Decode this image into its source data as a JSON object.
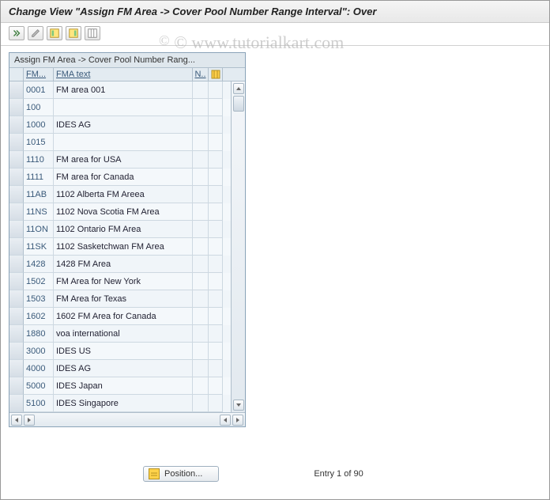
{
  "title": "Change View \"Assign FM Area -> Cover Pool Number Range Interval\": Over",
  "watermark": "© www.tutorialkart.com",
  "table": {
    "caption": "Assign FM Area -> Cover Pool Number Rang...",
    "headers": {
      "fm": "FM...",
      "txt": "FMA text",
      "n": "N.."
    },
    "rows": [
      {
        "fm": "0001",
        "txt": "FM area 001"
      },
      {
        "fm": "100",
        "txt": ""
      },
      {
        "fm": "1000",
        "txt": "IDES AG"
      },
      {
        "fm": "1015",
        "txt": ""
      },
      {
        "fm": "1110",
        "txt": "FM area for USA"
      },
      {
        "fm": "1111",
        "txt": "FM area for Canada"
      },
      {
        "fm": "11AB",
        "txt": "1102 Alberta FM Areea"
      },
      {
        "fm": "11NS",
        "txt": "1102 Nova Scotia FM Area"
      },
      {
        "fm": "11ON",
        "txt": "1102 Ontario FM Area"
      },
      {
        "fm": "11SK",
        "txt": "1102 Sasketchwan FM Area"
      },
      {
        "fm": "1428",
        "txt": "1428 FM Area"
      },
      {
        "fm": "1502",
        "txt": "FM Area for New York"
      },
      {
        "fm": "1503",
        "txt": "FM Area for Texas"
      },
      {
        "fm": "1602",
        "txt": "1602 FM Area for Canada"
      },
      {
        "fm": "1880",
        "txt": "voa international"
      },
      {
        "fm": "3000",
        "txt": "IDES US"
      },
      {
        "fm": "4000",
        "txt": "IDES AG"
      },
      {
        "fm": "5000",
        "txt": "IDES Japan"
      },
      {
        "fm": "5100",
        "txt": "IDES Singapore"
      }
    ]
  },
  "footer": {
    "position_label": "Position...",
    "entry_label": "Entry 1 of 90"
  }
}
